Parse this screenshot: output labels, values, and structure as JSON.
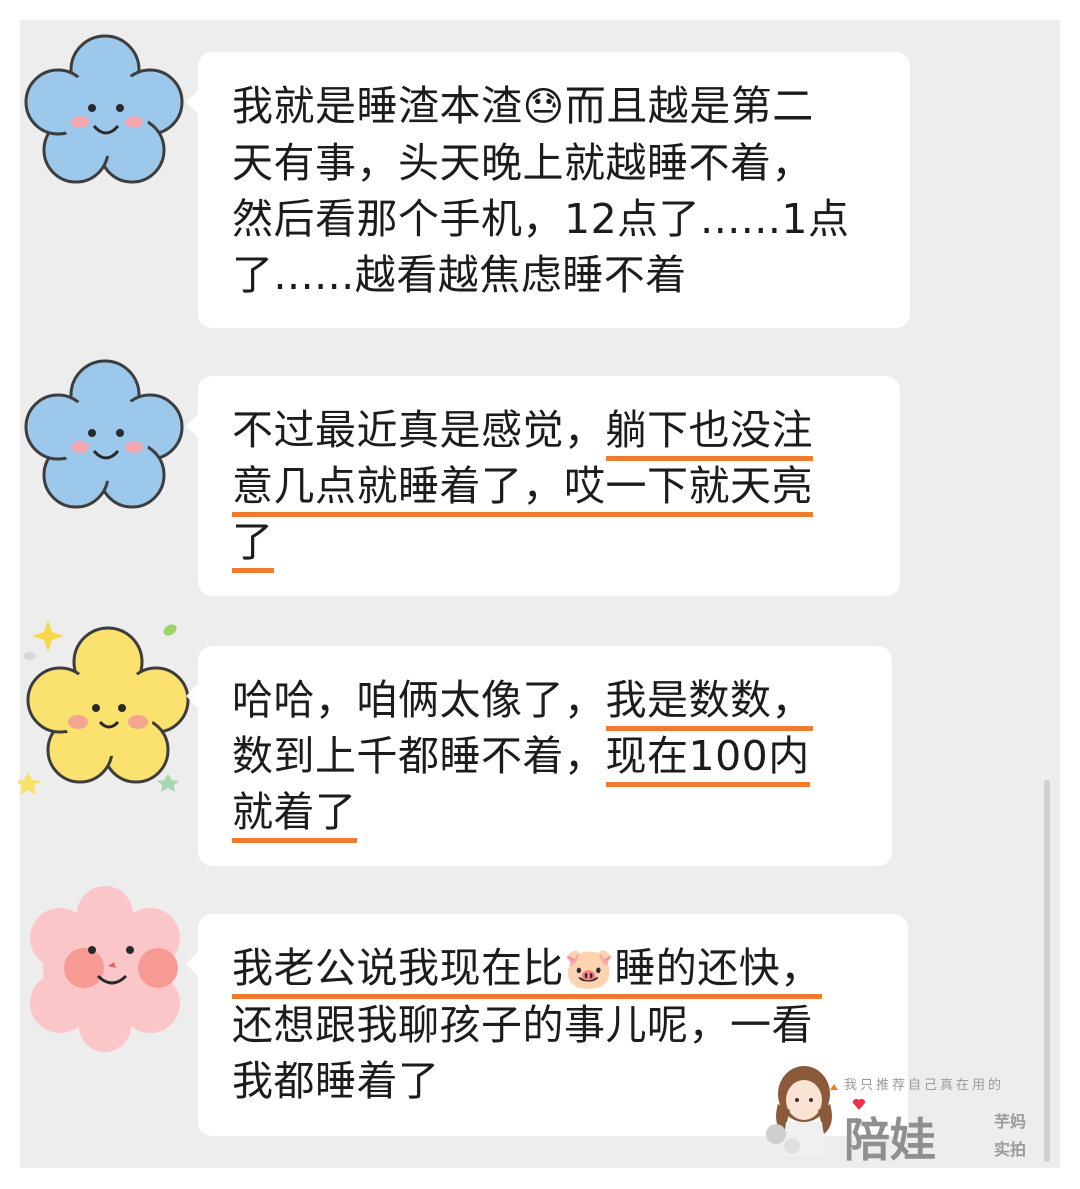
{
  "messages": [
    {
      "avatar": "blue-flower-avatar",
      "lines": [
        [
          "我就是睡渣本渣",
          "😓",
          "而且越是第二"
        ],
        [
          "天有事，头天晚上就越睡不着，"
        ],
        [
          "然后看那个手机，12点了......1点"
        ],
        [
          "了......越看越焦虑睡不着"
        ]
      ]
    },
    {
      "avatar": "blue-flower-avatar",
      "lines": [
        [
          "不过最近真是感觉，",
          "躺下也没注"
        ],
        [
          "意几点就睡着了，哎一下就天亮"
        ],
        [
          "了"
        ]
      ]
    },
    {
      "avatar": "yellow-flower-avatar",
      "lines": [
        [
          "哈哈，咱俩太像了，",
          "我是数数，"
        ],
        [
          "数到上千都睡不着，",
          "现在100内"
        ],
        [
          "就着了"
        ]
      ]
    },
    {
      "avatar": "pink-fluffy-avatar",
      "lines": [
        [
          "我老公说我现在比",
          "🐷",
          "睡的还快，"
        ],
        [
          "还想跟我聊孩子的事儿呢，一看"
        ],
        [
          "我都睡着了"
        ]
      ]
    }
  ],
  "watermark": {
    "slogan": "我只推荐自己真在用的",
    "brand": "陪娃",
    "author": "芋妈",
    "tag": "实拍"
  },
  "colors": {
    "background": "#ededed",
    "bubble": "#ffffff",
    "underline": "#f07b2c"
  }
}
